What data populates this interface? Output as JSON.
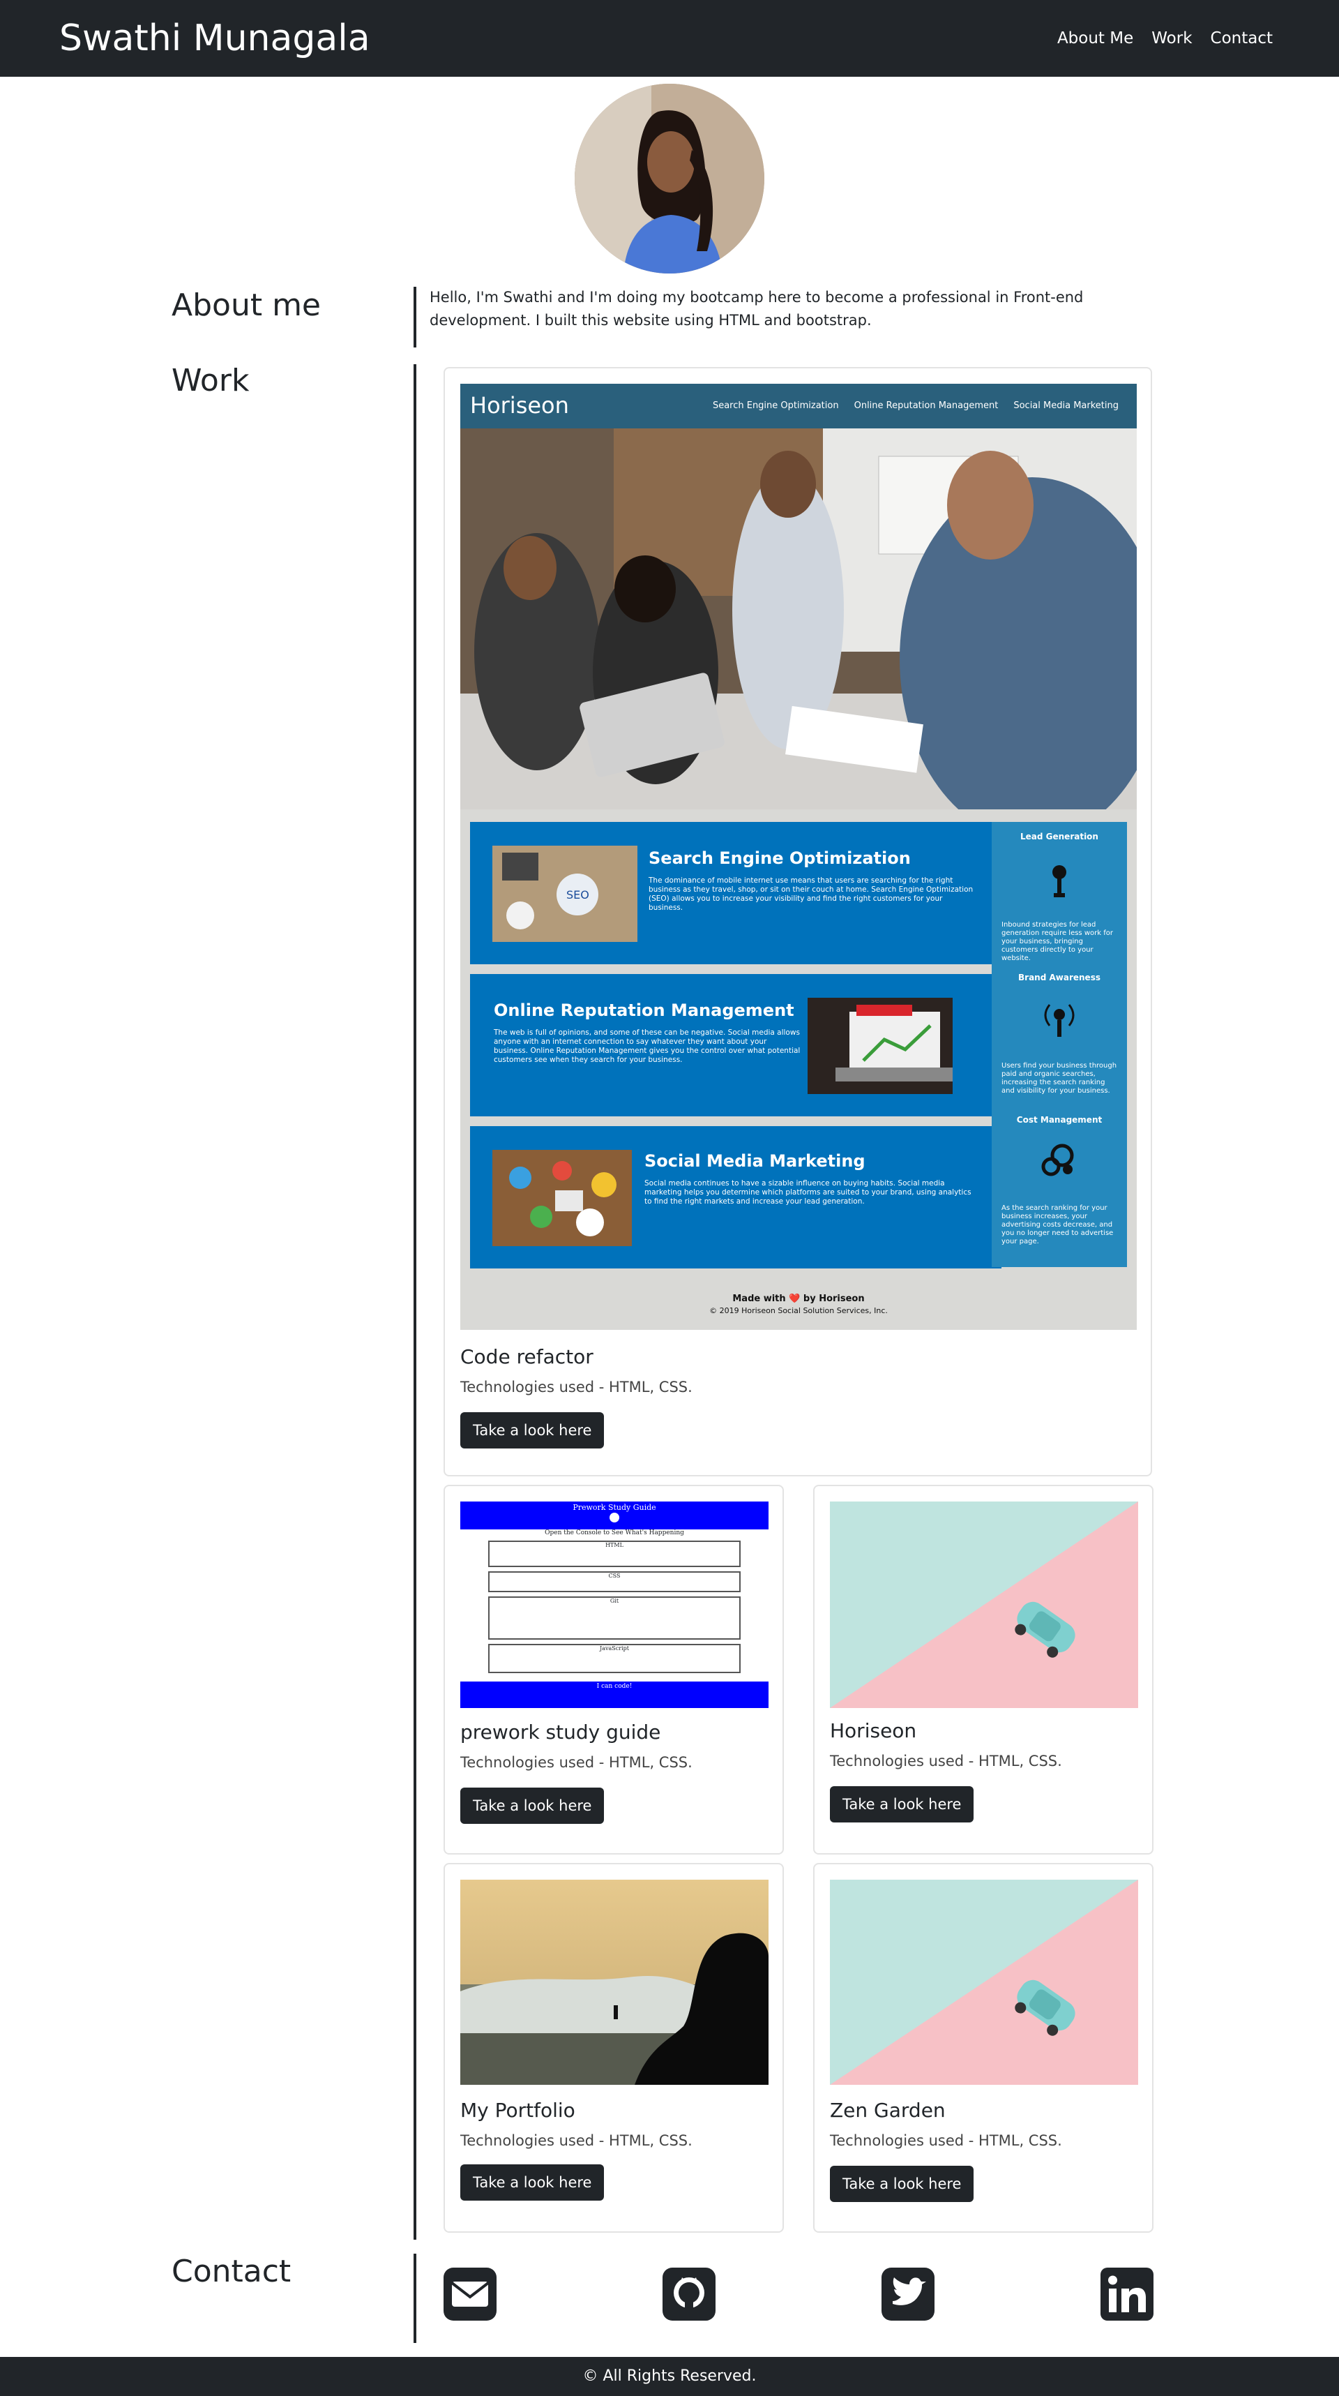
{
  "header": {
    "brand": "Swathi Munagala",
    "nav": [
      "About Me",
      "Work",
      "Contact"
    ]
  },
  "about": {
    "heading": "About me",
    "text": "Hello, I'm Swathi and I'm doing my bootcamp here to become a professional in Front-end development. I built this website using HTML and bootstrap."
  },
  "work": {
    "heading": "Work",
    "featured": {
      "title": "Code refactor",
      "tech": "Technologies used - HTML, CSS.",
      "button": "Take a look here",
      "preview": {
        "logo": "Horiseon",
        "menu": [
          "Search Engine Optimization",
          "Online Reputation Management",
          "Social Media Marketing"
        ],
        "boxes": [
          {
            "title": "Search Engine Optimization",
            "text": "The dominance of mobile internet use means that users are searching for the right business as they travel, shop, or sit on their couch at home. Search Engine Optimization (SEO) allows you to increase your visibility and find the right customers for your business."
          },
          {
            "title": "Online Reputation Management",
            "text": "The web is full of opinions, and some of these can be negative. Social media allows anyone with an internet connection to say whatever they want about your business. Online Reputation Management gives you the control over what potential customers see when they search for your business."
          },
          {
            "title": "Social Media Marketing",
            "text": "Social media continues to have a sizable influence on buying habits. Social media marketing helps you determine which platforms are suited to your brand, using analytics to find the right markets and increase your lead generation."
          }
        ],
        "side": [
          {
            "title": "Lead Generation",
            "text": "Inbound strategies for lead generation require less work for your business, bringing customers directly to your website."
          },
          {
            "title": "Brand Awareness",
            "text": "Users find your business through paid and organic searches, increasing the search ranking and visibility for your business."
          },
          {
            "title": "Cost Management",
            "text": "As the search ranking for your business increases, your advertising costs decrease, and you no longer need to advertise your page."
          }
        ],
        "footer_made": "Made with ❤️ by Horiseon",
        "footer_copy": "© 2019 Horiseon Social Solution Services, Inc."
      }
    },
    "cards": [
      {
        "title": "prework study guide",
        "tech": "Technologies used - HTML, CSS.",
        "button": "Take a look here",
        "preview": {
          "title": "Prework Study Guide",
          "subtitle": "Open the Console to See What's Happening",
          "sections": [
            "HTML",
            "CSS",
            "Git",
            "JavaScript"
          ],
          "footer": "I can code!"
        }
      },
      {
        "title": "Horiseon",
        "tech": "Technologies used - HTML, CSS.",
        "button": "Take a look here"
      },
      {
        "title": "My Portfolio",
        "tech": "Technologies used - HTML, CSS.",
        "button": "Take a look here"
      },
      {
        "title": "Zen Garden",
        "tech": "Technologies used - HTML, CSS.",
        "button": "Take a look here"
      }
    ]
  },
  "contact": {
    "heading": "Contact",
    "icons": [
      "envelope-icon",
      "github-icon",
      "twitter-icon",
      "linkedin-icon"
    ]
  },
  "footer": {
    "text": "© All Rights Reserved."
  },
  "colors": {
    "dark": "#212529",
    "horiseon_header": "#2a607c",
    "horiseon_box": "#0072bb",
    "horiseon_side": "#2589bd",
    "prework_blue": "#0000ff"
  }
}
